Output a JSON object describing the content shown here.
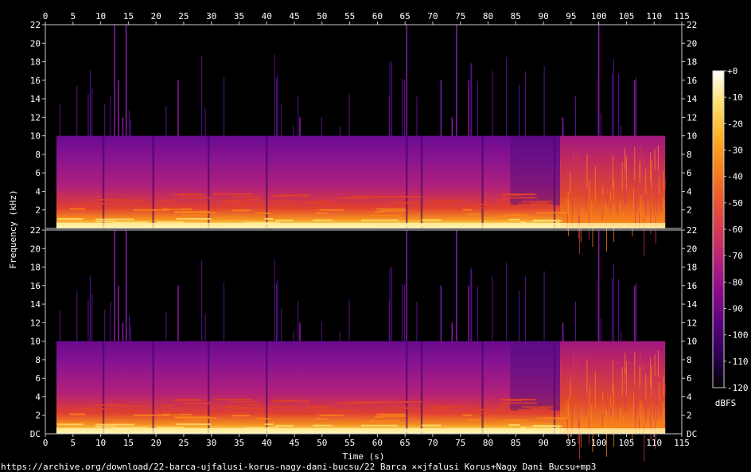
{
  "chart_data": {
    "type": "heatmap",
    "x_axis": {
      "label": "Time (s)",
      "range": [
        0,
        115
      ],
      "ticks": [
        "0",
        "5",
        "10",
        "15",
        "20",
        "25",
        "30",
        "35",
        "40",
        "45",
        "50",
        "55",
        "60",
        "65",
        "70",
        "75",
        "80",
        "85",
        "90",
        "95",
        "100",
        "105",
        "110",
        "115"
      ]
    },
    "y_axis": {
      "label": "Frequency (kHz)",
      "range": [
        0,
        22
      ],
      "ticks": [
        "2",
        "4",
        "6",
        "8",
        "10",
        "12",
        "14",
        "16",
        "18",
        "20",
        "22"
      ],
      "bottom_tick_label": "DC"
    },
    "channels": 2,
    "audio_duration_s": 112,
    "audio_start_s": 2,
    "cutoff_khz": 10,
    "tonal_section_start_s": 93,
    "transients_s": [
      12.5,
      13.2,
      14,
      14.6,
      24,
      46,
      65.3,
      71.5,
      73.5,
      74.3,
      76.5,
      93.5,
      100,
      106.5
    ],
    "colorbar": {
      "label": "dBFS",
      "range": [
        -120,
        0
      ],
      "ticks": [
        "+0",
        "-10",
        "-20",
        "-30",
        "-40",
        "-50",
        "-60",
        "-70",
        "-80",
        "-90",
        "-100",
        "-110",
        "-120"
      ],
      "colors": [
        "#000000",
        "#2a0050",
        "#5a007e",
        "#8a0a8a",
        "#b6207a",
        "#d83a55",
        "#ee5a2f",
        "#f8861a",
        "#fdb32a",
        "#fee070",
        "#ffffff"
      ]
    },
    "footer_text": "https://archive.org/download/22-barca-ujfalusi-korus-nagy-dani-bucsu/22 Barca ××jfalusi Korus+Nagy Dani Bucsu+mp3"
  }
}
